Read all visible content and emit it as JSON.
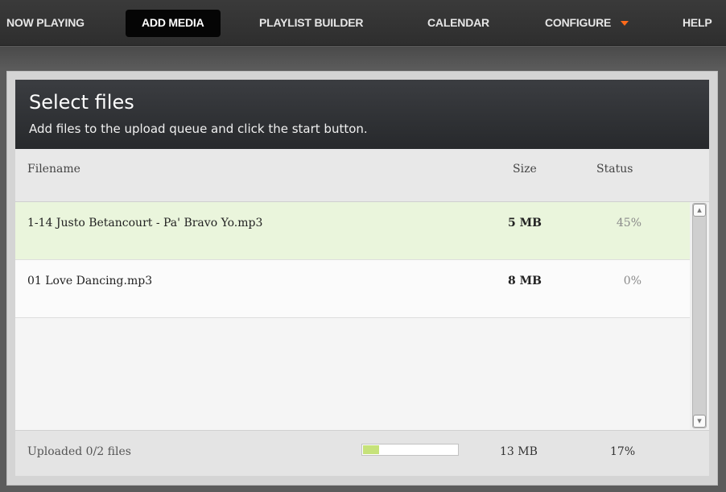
{
  "nav": {
    "items": [
      {
        "label": "NOW PLAYING"
      },
      {
        "label": "ADD MEDIA",
        "active": true
      },
      {
        "label": "PLAYLIST BUILDER"
      },
      {
        "label": "CALENDAR"
      },
      {
        "label": "CONFIGURE",
        "has_dropdown": true
      },
      {
        "label": "HELP"
      }
    ]
  },
  "uploader": {
    "title": "Select files",
    "subtitle": "Add files to the upload queue and click the start button.",
    "columns": {
      "filename": "Filename",
      "size": "Size",
      "status": "Status"
    },
    "files": [
      {
        "name": "1-14 Justo Betancourt - Pa' Bravo Yo.mp3",
        "size": "5 MB",
        "status": "45%"
      },
      {
        "name": "01 Love Dancing.mp3",
        "size": "8 MB",
        "status": "0%"
      }
    ],
    "footer": {
      "uploaded_text": "Uploaded 0/2 files",
      "total_size": "13 MB",
      "total_percent": "17%",
      "progress": 0.17
    }
  },
  "colors": {
    "accent": "#ff6a1a",
    "active_row": "#eaf5dc",
    "progress_fill": "#c6e27a"
  }
}
